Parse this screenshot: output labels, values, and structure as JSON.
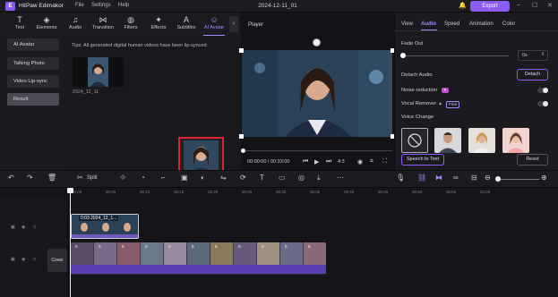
{
  "app": {
    "name": "HitPaw Edimakor",
    "menus": [
      "File",
      "Settings",
      "Help"
    ],
    "document_title": "2024-12-11_01",
    "export_label": "Export"
  },
  "toolbar": {
    "items": [
      {
        "label": "Text",
        "icon": "text-icon"
      },
      {
        "label": "Elements",
        "icon": "elements-icon"
      },
      {
        "label": "Audio",
        "icon": "audio-icon"
      },
      {
        "label": "Transition",
        "icon": "transition-icon"
      },
      {
        "label": "Filters",
        "icon": "filters-icon"
      },
      {
        "label": "Effects",
        "icon": "effects-icon"
      },
      {
        "label": "Subtitles",
        "icon": "subtitles-icon"
      },
      {
        "label": "AI Avatar",
        "icon": "ai-avatar-icon",
        "active": true
      }
    ]
  },
  "leftnav": {
    "items": [
      "AI Avatar",
      "Talking Photo",
      "Video Lip-sync",
      "Result"
    ],
    "selected": "Result"
  },
  "library": {
    "tip": "Tips: All generated digital human videos have been lip-synced.",
    "items": [
      {
        "name": "2024_12_11"
      }
    ]
  },
  "player": {
    "label": "Player",
    "timecode": "00:00:00 / 00:33:00",
    "aspect": "4:3"
  },
  "right_panel": {
    "tabs": [
      "View",
      "Audio",
      "Speed",
      "Animation",
      "Color"
    ],
    "selected_tab": "Audio",
    "fade_out_label": "Fade Out",
    "fade_out_value": "0s",
    "detach_audio_label": "Detach Audio",
    "detach_button": "Detach",
    "noise_reduction_label": "Noise reduction",
    "vocal_remover_label": "Vocal Remover",
    "free_badge": "Free",
    "voice_change_label": "Voice Change",
    "speech_to_text": "Speech to Text",
    "reset": "Reset"
  },
  "edit_toolbar": {
    "split_label": "Split"
  },
  "timeline": {
    "ticks": [
      "00:00",
      "00:05",
      "00:10",
      "00:15",
      "00:20",
      "00:25",
      "00:30",
      "00:35",
      "00:40",
      "00:45",
      "00:50",
      "00:55",
      "01:00"
    ],
    "overlay_clip_label": "0:03 2024_12_1...",
    "cover_label": "Cover",
    "frame_badges": [
      "0",
      "0",
      "0",
      "0",
      "0",
      "0",
      "0",
      "0",
      "0",
      "0",
      "0"
    ]
  },
  "colors": {
    "accent": "#8b5cf6",
    "highlight_box": "#e0242f"
  }
}
